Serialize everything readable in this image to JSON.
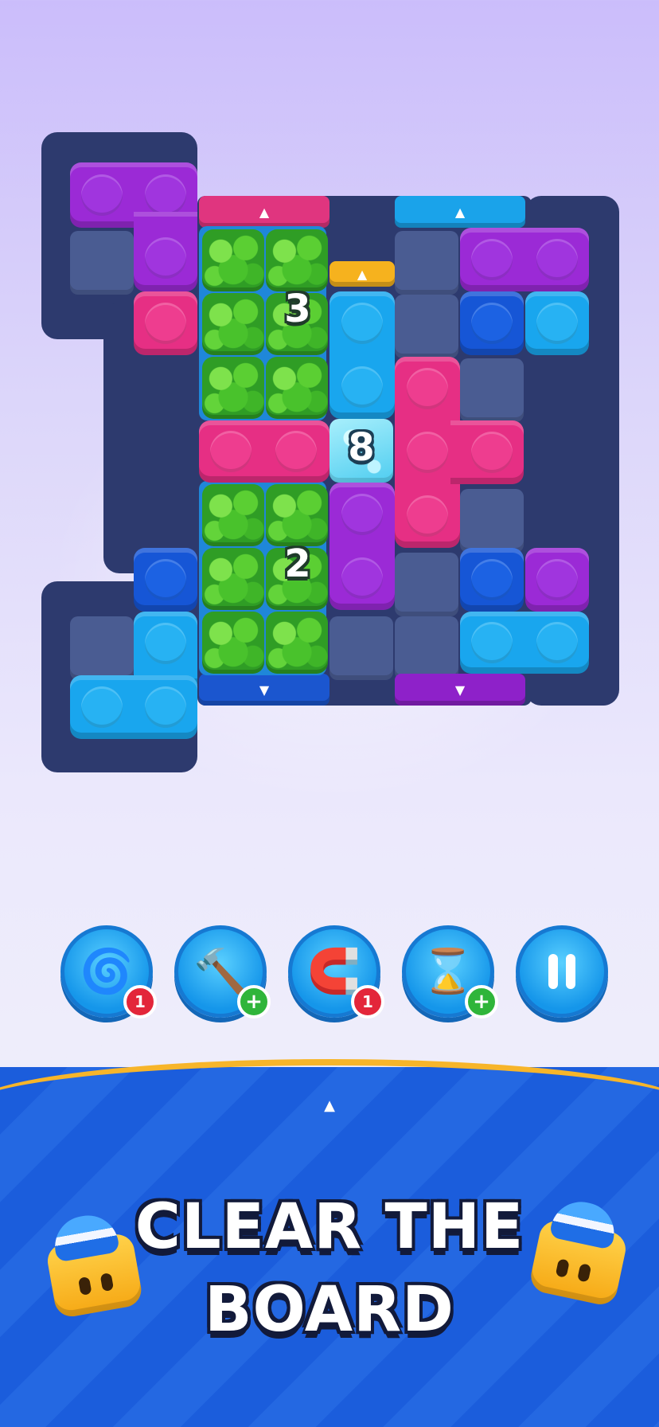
{
  "board": {
    "counters": {
      "grass_top": "3",
      "ice": "8",
      "grass_bottom": "2"
    },
    "exit_arrows": {
      "up": "▲",
      "down": "▼"
    },
    "colors": {
      "frame": "#2d3a6e",
      "purple": "#9b2ad6",
      "pink": "#e62f84",
      "cyan": "#19a6ee",
      "blue": "#1656d6",
      "yellow_exit": "#f6b21e",
      "grass": "#2f9d25",
      "ice": "#a8effc"
    }
  },
  "boosters": [
    {
      "name": "propeller",
      "icon": "propeller-icon",
      "glyph": "🌀",
      "badge": "1",
      "badge_type": "count"
    },
    {
      "name": "hammer",
      "icon": "hammer-icon",
      "glyph": "🔨",
      "badge": "+",
      "badge_type": "add"
    },
    {
      "name": "magnet",
      "icon": "magnet-icon",
      "glyph": "🧲",
      "badge": "1",
      "badge_type": "count"
    },
    {
      "name": "hourglass",
      "icon": "hourglass-icon",
      "glyph": "⌛",
      "badge": "+",
      "badge_type": "add"
    },
    {
      "name": "pause",
      "icon": "pause-icon"
    }
  ],
  "banner": {
    "tab_arrow": "▲",
    "headline_line1": "CLEAR THE",
    "headline_line2": "BOARD",
    "colors": {
      "rim": "#f7b52a",
      "stripe_a": "#1b5ddc",
      "stripe_b": "#2468e2"
    }
  }
}
